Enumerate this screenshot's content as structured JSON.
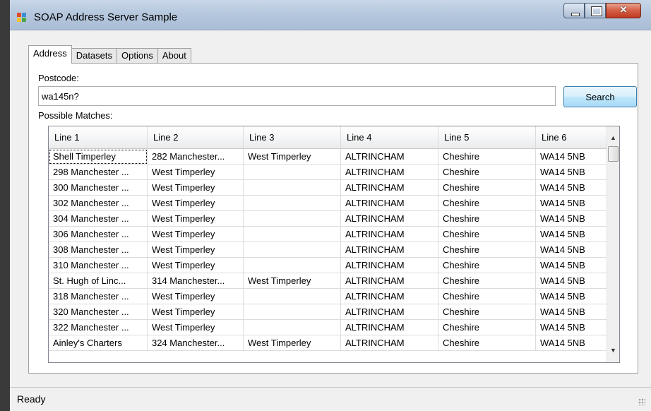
{
  "window": {
    "title": "SOAP Address Server Sample",
    "accent_color": "#c0391f"
  },
  "tabs": [
    {
      "label": "Address",
      "active": true
    },
    {
      "label": "Datasets",
      "active": false
    },
    {
      "label": "Options",
      "active": false
    },
    {
      "label": "About",
      "active": false
    }
  ],
  "form": {
    "postcode_label": "Postcode:",
    "postcode_value": "wa145n?",
    "search_label": "Search",
    "matches_label": "Possible Matches:"
  },
  "grid": {
    "columns": [
      "Line 1",
      "Line 2",
      "Line 3",
      "Line 4",
      "Line 5",
      "Line 6"
    ],
    "rows": [
      [
        "Shell Timperley",
        "282 Manchester...",
        "West Timperley",
        "ALTRINCHAM",
        "Cheshire",
        "WA14 5NB"
      ],
      [
        "298 Manchester ...",
        "West Timperley",
        "",
        "ALTRINCHAM",
        "Cheshire",
        "WA14 5NB"
      ],
      [
        "300 Manchester ...",
        "West Timperley",
        "",
        "ALTRINCHAM",
        "Cheshire",
        "WA14 5NB"
      ],
      [
        "302 Manchester ...",
        "West Timperley",
        "",
        "ALTRINCHAM",
        "Cheshire",
        "WA14 5NB"
      ],
      [
        "304 Manchester ...",
        "West Timperley",
        "",
        "ALTRINCHAM",
        "Cheshire",
        "WA14 5NB"
      ],
      [
        "306 Manchester ...",
        "West Timperley",
        "",
        "ALTRINCHAM",
        "Cheshire",
        "WA14 5NB"
      ],
      [
        "308 Manchester ...",
        "West Timperley",
        "",
        "ALTRINCHAM",
        "Cheshire",
        "WA14 5NB"
      ],
      [
        "310 Manchester ...",
        "West Timperley",
        "",
        "ALTRINCHAM",
        "Cheshire",
        "WA14 5NB"
      ],
      [
        "St. Hugh of Linc...",
        "314 Manchester...",
        "West Timperley",
        "ALTRINCHAM",
        "Cheshire",
        "WA14 5NB"
      ],
      [
        "318 Manchester ...",
        "West Timperley",
        "",
        "ALTRINCHAM",
        "Cheshire",
        "WA14 5NB"
      ],
      [
        "320 Manchester ...",
        "West Timperley",
        "",
        "ALTRINCHAM",
        "Cheshire",
        "WA14 5NB"
      ],
      [
        "322 Manchester ...",
        "West Timperley",
        "",
        "ALTRINCHAM",
        "Cheshire",
        "WA14 5NB"
      ],
      [
        "Ainley's Charters",
        "324 Manchester...",
        "West Timperley",
        "ALTRINCHAM",
        "Cheshire",
        "WA14 5NB"
      ]
    ]
  },
  "status": {
    "text": "Ready"
  }
}
